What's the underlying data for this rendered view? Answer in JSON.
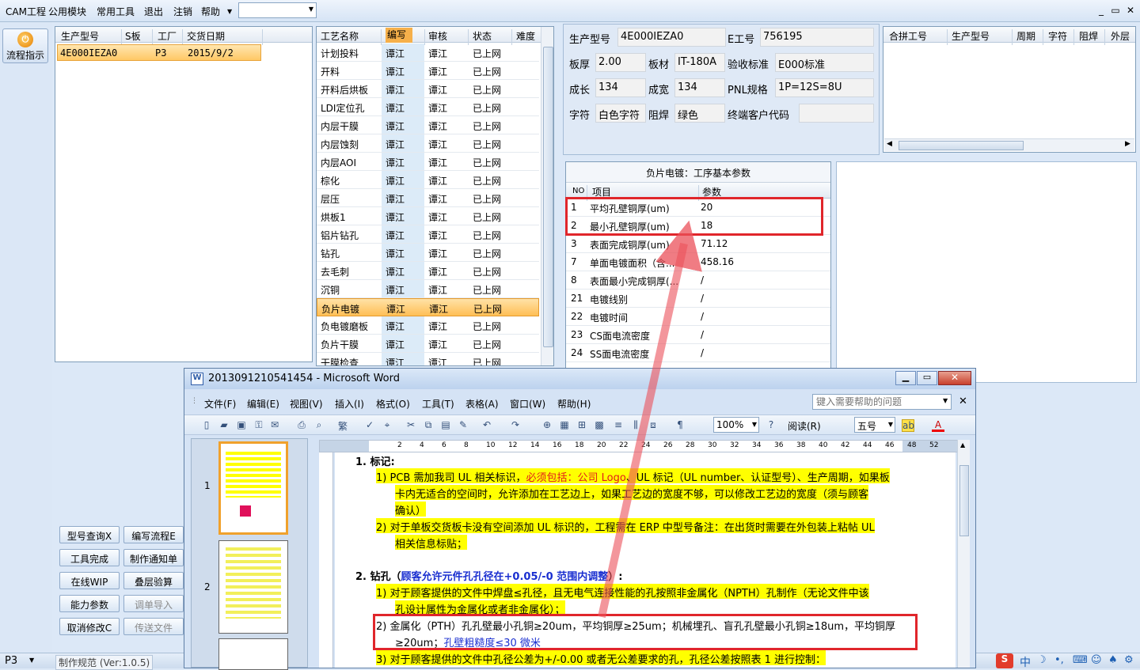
{
  "menu": {
    "items": [
      "CAM工程",
      "公用模块",
      "常用工具",
      "退出",
      "注销",
      "帮助"
    ],
    "combo_value": ""
  },
  "window_controls": [
    "_",
    "▭",
    "✕"
  ],
  "left_bar": {
    "flow_button_label": "流程指示"
  },
  "orders": {
    "headers": [
      "生产型号",
      "S板",
      "工厂",
      "交货日期"
    ],
    "rows": [
      {
        "model": "4E000IEZA0",
        "s_board": "",
        "factory": "P3",
        "date": "2015/9/2"
      }
    ]
  },
  "processes": {
    "headers": [
      "工艺名称",
      "编写",
      "审核",
      "状态",
      "难度"
    ],
    "rows": [
      [
        "计划投料",
        "谭江",
        "谭江",
        "已上网"
      ],
      [
        "开料",
        "谭江",
        "谭江",
        "已上网"
      ],
      [
        "开料后烘板",
        "谭江",
        "谭江",
        "已上网"
      ],
      [
        "LDI定位孔",
        "谭江",
        "谭江",
        "已上网"
      ],
      [
        "内层干膜",
        "谭江",
        "谭江",
        "已上网"
      ],
      [
        "内层蚀刻",
        "谭江",
        "谭江",
        "已上网"
      ],
      [
        "内层AOI",
        "谭江",
        "谭江",
        "已上网"
      ],
      [
        "棕化",
        "谭江",
        "谭江",
        "已上网"
      ],
      [
        "层压",
        "谭江",
        "谭江",
        "已上网"
      ],
      [
        "烘板1",
        "谭江",
        "谭江",
        "已上网"
      ],
      [
        "铝片钻孔",
        "谭江",
        "谭江",
        "已上网"
      ],
      [
        "钻孔",
        "谭江",
        "谭江",
        "已上网"
      ],
      [
        "去毛刺",
        "谭江",
        "谭江",
        "已上网"
      ],
      [
        "沉铜",
        "谭江",
        "谭江",
        "已上网"
      ],
      [
        "负片电镀",
        "谭江",
        "谭江",
        "已上网"
      ],
      [
        "负电镀磨板",
        "谭江",
        "谭江",
        "已上网"
      ],
      [
        "负片干膜",
        "谭江",
        "谭江",
        "已上网"
      ],
      [
        "干膜检查",
        "谭江",
        "谭江",
        "已上网"
      ]
    ],
    "selected_index": 14
  },
  "info": {
    "model_label": "生产型号",
    "model": "4E000IEZA0",
    "e_label": "E工号",
    "e_no": "756195",
    "thickness_label": "板厚",
    "thickness": "2.00",
    "material_label": "板材",
    "material": "IT-180A",
    "standard_label": "验收标准",
    "standard": "E000标准",
    "length_label": "成长",
    "length": "134",
    "width_label": "成宽",
    "width": "134",
    "pnl_label": "PNL规格",
    "pnl": "1P=12S=8U",
    "char_label": "字符",
    "char": "白色字符",
    "mask_label": "阻焊",
    "mask": "绿色",
    "end_customer_label": "终端客户代码",
    "end_customer": ""
  },
  "merge": {
    "headers": [
      "合拼工号",
      "生产型号",
      "周期",
      "字符",
      "阻焊",
      "外层"
    ]
  },
  "params": {
    "title": "负片电镀：工序基本参数",
    "headers": [
      "NO",
      "项目",
      "参数"
    ],
    "rows": [
      [
        "1",
        "平均孔壁铜厚(um)",
        "20"
      ],
      [
        "2",
        "最小孔壁铜厚(um)",
        "18"
      ],
      [
        "3",
        "表面完成铜厚(um)",
        "71.12"
      ],
      [
        "7",
        "单面电镀面积（含...",
        "458.16"
      ],
      [
        "8",
        "表面最小完成铜厚(...",
        "/"
      ],
      [
        "21",
        "电镀线别",
        "/"
      ],
      [
        "22",
        "电镀时间",
        "/"
      ],
      [
        "23",
        "CS面电流密度",
        "/"
      ],
      [
        "24",
        "SS面电流密度",
        "/"
      ]
    ]
  },
  "buttons": [
    "型号查询X",
    "编写流程E",
    "工具完成",
    "制作通知单",
    "在线WIP",
    "叠层验算",
    "能力参数",
    "调单导入",
    "取消修改C",
    "传送文件"
  ],
  "status": {
    "left": "P3",
    "version": "制作规范 (Ver:1.0.5)",
    "ime": "中"
  },
  "word": {
    "title": "2013091210541454 - Microsoft Word",
    "menu": [
      "文件(F)",
      "编辑(E)",
      "视图(V)",
      "插入(I)",
      "格式(O)",
      "工具(T)",
      "表格(A)",
      "窗口(W)",
      "帮助(H)"
    ],
    "help_placeholder": "键入需要帮助的问题",
    "zoom": "100%",
    "read_label": "阅读(R)",
    "font_size": "五号",
    "page_labels": [
      "1",
      "2"
    ],
    "ruler_marks": [
      "2",
      "4",
      "6",
      "8",
      "10",
      "12",
      "14",
      "16",
      "18",
      "20",
      "22",
      "24",
      "26",
      "28",
      "30",
      "32",
      "34",
      "36",
      "38",
      "40",
      "42",
      "44",
      "46",
      "48",
      "52"
    ],
    "doc": {
      "h1": "1.   标记:",
      "l1a": "1)   PCB 需加我司 UL 相关标识，",
      "l1a_red": "必须包括：公司 Logo",
      "l1a_end": "、UL 标记（UL number、认证型号）、生产周期，如果板",
      "l1b": "卡内无适合的空间时，允许添加在工艺边上，如果工艺边的宽度不够，可以修改工艺边的宽度（须与顾客",
      "l1c": "确认）",
      "l2a": "2)   对于单板交货板卡没有空间添加 UL 标识的，工程需在 ERP 中型号备注：在出货时需要在外包装上粘帖 UL",
      "l2b": "相关信息标贴；",
      "h2": "2.   钻孔（",
      "h2_blue": "顾客允许元件孔孔径在+0.05/-0 范围内调整",
      "h2_end": "）:",
      "d1a": "1)   对于顾客提供的文件中焊盘≤孔径，且无电气连接性能的孔按照非金属化（NPTH）孔制作（无论文件中该",
      "d1b": "孔设计属性为金属化或者非金属化）；",
      "d2a_pre": "2)   ",
      "d2a": "金属化（PTH）孔孔壁最小孔铜≥20um，平均铜厚≥25um；机械埋孔、盲孔孔壁最小孔铜≥18um，平均铜厚",
      "d2b": "≥20um；",
      "d2b_blue": "孔壁粗糙度≤30 微米",
      "d3": "3)   对于顾客提供的文件中孔径公差为+/-0.00 或者无公差要求的孔，孔径公差按照表 1 进行控制："
    }
  }
}
